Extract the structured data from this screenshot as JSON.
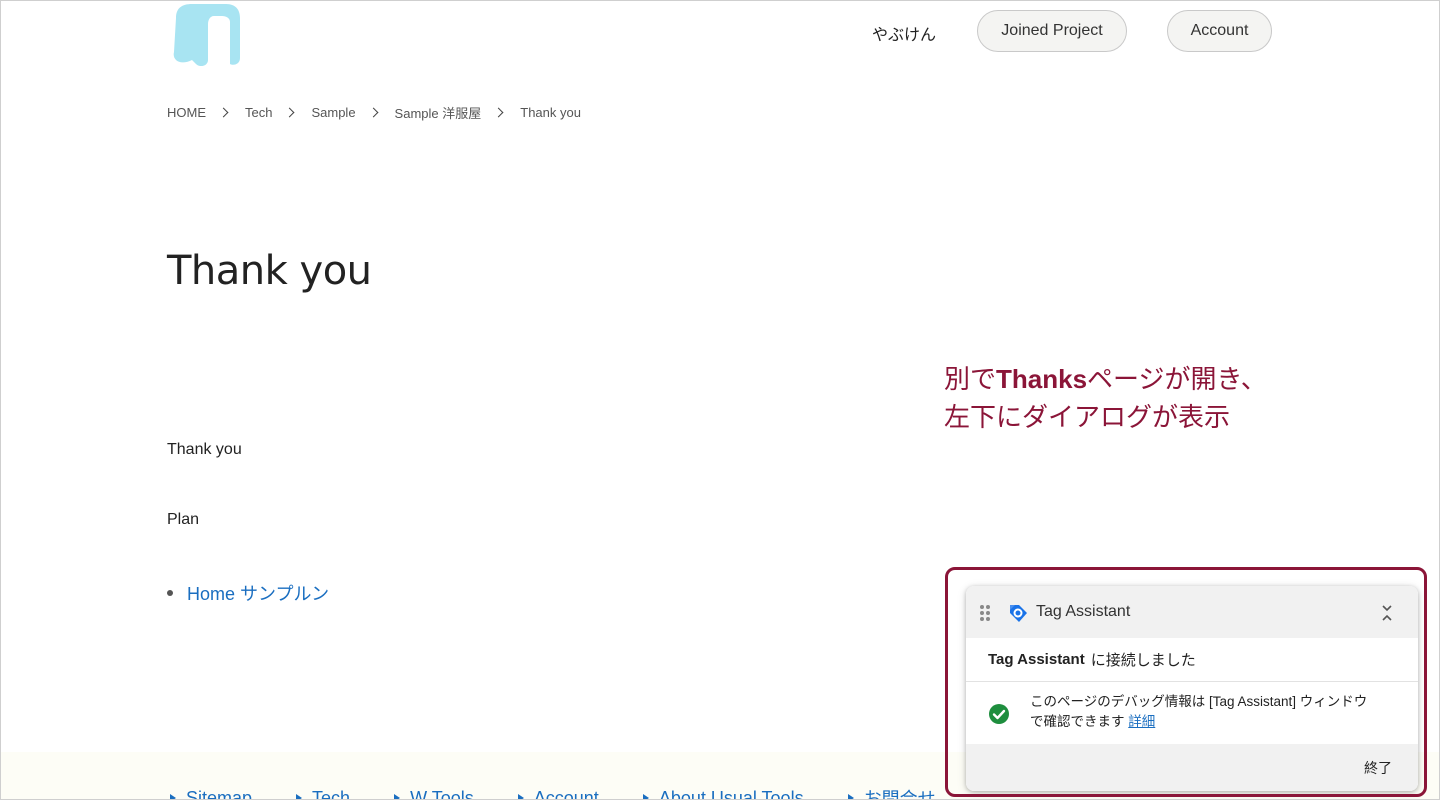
{
  "header": {
    "user_name": "やぶけん",
    "joined_project_label": "Joined Project",
    "account_label": "Account",
    "logo_color": "#a8e4f2"
  },
  "breadcrumb": [
    "HOME",
    "Tech",
    "Sample",
    "Sample 洋服屋",
    "Thank you"
  ],
  "main": {
    "title": "Thank you",
    "text1": "Thank you",
    "text2": "Plan",
    "list_link": "Home サンプルン"
  },
  "annotation": {
    "line1_prefix": "別で",
    "line1_bold": "Thanks",
    "line1_suffix": "ページが開き、",
    "line2": "左下にダイアログが表示",
    "color": "#8b1538"
  },
  "tag_assistant": {
    "title": "Tag Assistant",
    "connected_bold": "Tag Assistant",
    "connected_text": "に接続しました",
    "message": "このページのデバッグ情報は [Tag Assistant] ウィンドウで確認できます",
    "details_link": "詳細",
    "end_button": "終了"
  },
  "footer": {
    "links": [
      "Sitemap",
      "Tech",
      "W Tools",
      "Account",
      "About Usual Tools",
      "お問合せ"
    ]
  }
}
